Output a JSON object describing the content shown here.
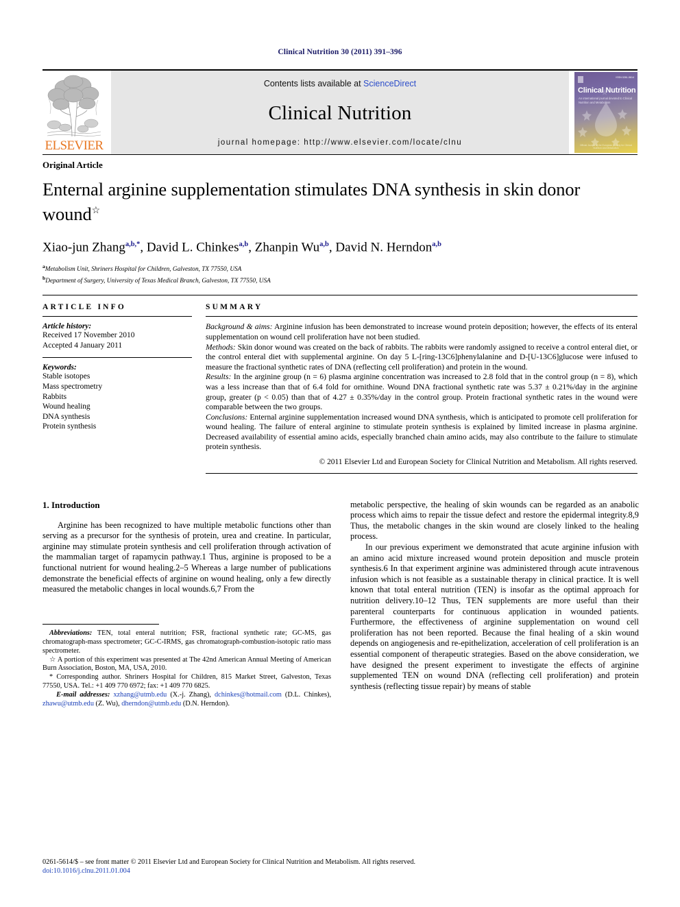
{
  "running_head": "Clinical Nutrition 30 (2011) 391–396",
  "masthead": {
    "publisher_name": "ELSEVIER",
    "contents_prefix": "Contents lists available at ",
    "contents_link": "ScienceDirect",
    "journal_title": "Clinical Nutrition",
    "homepage": "journal homepage: http://www.elsevier.com/locate/clnu",
    "cover": {
      "title": "Clinical Nutrition",
      "subtitle": "An international journal devoted to Clinical Nutrition and Metabolism",
      "issn": "ISSN 0261-5614",
      "footer": "Official Journal of the European Society for Clinical Nutrition and Metabolism"
    }
  },
  "article": {
    "type": "Original Article",
    "title": "Enternal arginine supplementation stimulates DNA synthesis in skin donor wound",
    "title_footnote_mark": "☆",
    "authors": [
      {
        "name": "Xiao-jun Zhang",
        "sup": "a,b,*"
      },
      {
        "name": "David L. Chinkes",
        "sup": "a,b"
      },
      {
        "name": "Zhanpin Wu",
        "sup": "a,b"
      },
      {
        "name": "David N. Herndon",
        "sup": "a,b"
      }
    ],
    "affiliations": [
      {
        "mark": "a",
        "text": "Metabolism Unit, Shriners Hospital for Children, Galveston, TX 77550, USA"
      },
      {
        "mark": "b",
        "text": "Department of Surgery, University of Texas Medical Branch, Galveston, TX 77550, USA"
      }
    ]
  },
  "article_info": {
    "heading": "ARTICLE INFO",
    "history_label": "Article history:",
    "history": [
      "Received 17 November 2010",
      "Accepted 4 January 2011"
    ],
    "keywords_label": "Keywords:",
    "keywords": [
      "Stable isotopes",
      "Mass spectrometry",
      "Rabbits",
      "Wound healing",
      "DNA synthesis",
      "Protein synthesis"
    ]
  },
  "summary": {
    "heading": "SUMMARY",
    "sections": [
      {
        "label": "Background & aims:",
        "text": " Arginine infusion has been demonstrated to increase wound protein deposition; however, the effects of its enteral supplementation on wound cell proliferation have not been studied."
      },
      {
        "label": "Methods:",
        "text": " Skin donor wound was created on the back of rabbits. The rabbits were randomly assigned to receive a control enteral diet, or the control enteral diet with supplemental arginine. On day 5 L-[ring-13C6]phenylalanine and D-[U-13C6]glucose were infused to measure the fractional synthetic rates of DNA (reflecting cell proliferation) and protein in the wound."
      },
      {
        "label": "Results:",
        "text": " In the arginine group (n = 6) plasma arginine concentration was increased to 2.8 fold that in the control group (n = 8), which was a less increase than that of 6.4 fold for ornithine. Wound DNA fractional synthetic rate was 5.37 ± 0.21%/day in the arginine group, greater (p < 0.05) than that of 4.27 ± 0.35%/day in the control group. Protein fractional synthetic rates in the wound were comparable between the two groups."
      },
      {
        "label": "Conclusions:",
        "text": " Enternal arginine supplementation increased wound DNA synthesis, which is anticipated to promote cell proliferation for wound healing. The failure of enteral arginine to stimulate protein synthesis is explained by limited increase in plasma arginine. Decreased availability of essential amino acids, especially branched chain amino acids, may also contribute to the failure to stimulate protein synthesis."
      }
    ],
    "copyright": "© 2011 Elsevier Ltd and European Society for Clinical Nutrition and Metabolism. All rights reserved."
  },
  "body": {
    "section_number_title": "1. Introduction",
    "left_paragraph": "Arginine has been recognized to have multiple metabolic functions other than serving as a precursor for the synthesis of protein, urea and creatine. In particular, arginine may stimulate protein synthesis and cell proliferation through activation of the mammalian target of rapamycin pathway.1 Thus, arginine is proposed to be a functional nutrient for wound healing.2–5 Whereas a large number of publications demonstrate the beneficial effects of arginine on wound healing, only a few directly measured the metabolic changes in local wounds.6,7 From the",
    "right_paragraph_1": "metabolic perspective, the healing of skin wounds can be regarded as an anabolic process which aims to repair the tissue defect and restore the epidermal integrity.8,9 Thus, the metabolic changes in the skin wound are closely linked to the healing process.",
    "right_paragraph_2": "In our previous experiment we demonstrated that acute arginine infusion with an amino acid mixture increased wound protein deposition and muscle protein synthesis.6 In that experiment arginine was administered through acute intravenous infusion which is not feasible as a sustainable therapy in clinical practice. It is well known that total enteral nutrition (TEN) is insofar as the optimal approach for nutrition delivery.10–12 Thus, TEN supplements are more useful than their parenteral counterparts for continuous application in wounded patients. Furthermore, the effectiveness of arginine supplementation on wound cell proliferation has not been reported. Because the final healing of a skin wound depends on angiogenesis and re-epithelization, acceleration of cell proliferation is an essential component of therapeutic strategies. Based on the above consideration, we have designed the present experiment to investigate the effects of arginine supplemented TEN on wound DNA (reflecting cell proliferation) and protein synthesis (reflecting tissue repair) by means of stable"
  },
  "footnotes": {
    "abbreviations_label": "Abbreviations:",
    "abbreviations_text": " TEN, total enteral nutrition; FSR, fractional synthetic rate; GC-MS, gas chromatograph-mass spectrometer; GC-C-IRMS, gas chromatograph-combustion-isotopic ratio mass spectrometer.",
    "star_mark": "☆",
    "star_text": " A portion of this experiment was presented at The 42nd American Annual Meeting of American Burn Association, Boston, MA, USA, 2010.",
    "corresponding_mark": "*",
    "corresponding_text": " Corresponding author. Shriners Hospital for Children, 815 Market Street, Galveston, Texas 77550, USA. Tel.: +1 409 770 6972; fax: +1 409 770 6825.",
    "email_label": "E-mail addresses:",
    "emails": [
      {
        "address": "xzhang@utmb.edu",
        "owner": "(X.-j. Zhang)"
      },
      {
        "address": "dchinkes@hotmail.com",
        "owner": "(D.L. Chinkes)"
      },
      {
        "address": "zhawu@utmb.edu",
        "owner": "(Z. Wu)"
      },
      {
        "address": "dherndon@utmb.edu",
        "owner": "(D.N. Herndon)"
      }
    ]
  },
  "page_footer": {
    "issn_line": "0261-5614/$ – see front matter © 2011 Elsevier Ltd and European Society for Clinical Nutrition and Metabolism. All rights reserved.",
    "doi_line": "doi:10.1016/j.clnu.2011.01.004"
  }
}
